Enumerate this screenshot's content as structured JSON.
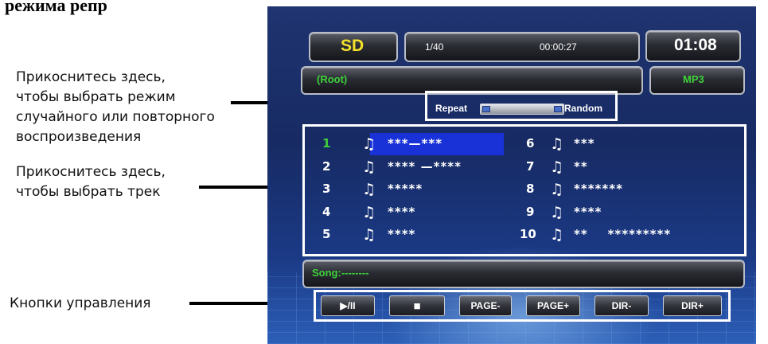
{
  "heading": "режима репр",
  "callouts": {
    "mode": "Прикоснитесь здесь,\nчтобы выбрать режим\nслучайного или повторного\nвоспроизведения",
    "track": "Прикоснитесь здесь,\nчтобы выбрать трек",
    "controls": "Кнопки управления"
  },
  "status": {
    "source": "SD",
    "track_count": "1/40",
    "elapsed": "00:00:27",
    "clock": "01:08",
    "folder": "(Root)",
    "format": "MP3"
  },
  "mode": {
    "repeat_label": "Repeat",
    "random_label": "Random"
  },
  "tracks": [
    {
      "num": "1",
      "title": "***—***",
      "active": true
    },
    {
      "num": "2",
      "title": "**** —****"
    },
    {
      "num": "3",
      "title": "*****"
    },
    {
      "num": "4",
      "title": "****"
    },
    {
      "num": "5",
      "title": "****"
    },
    {
      "num": "6",
      "title": "***"
    },
    {
      "num": "7",
      "title": "**"
    },
    {
      "num": "8",
      "title": "*******"
    },
    {
      "num": "9",
      "title": "****"
    },
    {
      "num": "10",
      "title": "**    *********"
    }
  ],
  "track_icon": "music-note-icon",
  "song": "Song:--------",
  "controls": {
    "play_pause": "▶/II",
    "stop": "■",
    "page_prev": "PAGE-",
    "page_next": "PAGE+",
    "dir_prev": "DIR-",
    "dir_next": "DIR+"
  },
  "colors": {
    "accent_green": "#3fd23a",
    "accent_yellow": "#f4e12a",
    "highlight_blue": "#1932d8",
    "screen_bg": "#172a63"
  }
}
